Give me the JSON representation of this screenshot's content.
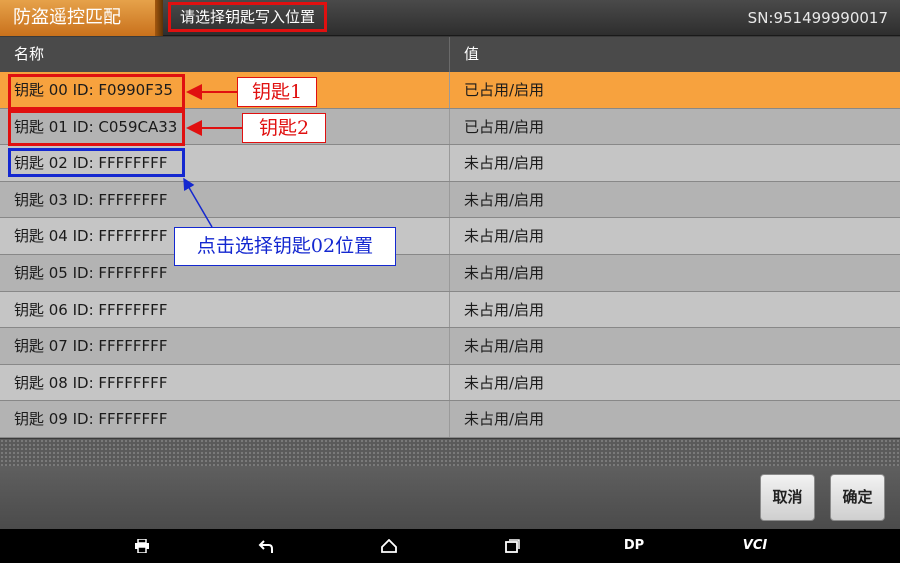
{
  "app": {
    "title": "防盗遥控匹配",
    "subtitle": "请选择钥匙写入位置",
    "serial": "SN:951499990017"
  },
  "table": {
    "headers": [
      "名称",
      "值"
    ],
    "rows": [
      {
        "name": "钥匙 00 ID: F0990F35",
        "value": "已占用/启用",
        "selected": true
      },
      {
        "name": "钥匙 01 ID: C059CA33",
        "value": "已占用/启用"
      },
      {
        "name": "钥匙 02 ID: FFFFFFFF",
        "value": "未占用/启用"
      },
      {
        "name": "钥匙 03 ID: FFFFFFFF",
        "value": "未占用/启用"
      },
      {
        "name": "钥匙 04 ID: FFFFFFFF",
        "value": "未占用/启用"
      },
      {
        "name": "钥匙 05 ID: FFFFFFFF",
        "value": "未占用/启用"
      },
      {
        "name": "钥匙 06 ID: FFFFFFFF",
        "value": "未占用/启用"
      },
      {
        "name": "钥匙 07 ID: FFFFFFFF",
        "value": "未占用/启用"
      },
      {
        "name": "钥匙 08 ID: FFFFFFFF",
        "value": "未占用/启用"
      },
      {
        "name": "钥匙 09 ID: FFFFFFFF",
        "value": "未占用/启用"
      }
    ]
  },
  "annotations": {
    "key1": "钥匙1",
    "key2": "钥匙2",
    "select_hint": "点击选择钥匙02位置"
  },
  "buttons": {
    "cancel": "取消",
    "ok": "确定"
  },
  "navbar": {
    "dp": "DP",
    "vci": "VCI",
    "icons": [
      "print-icon",
      "back-icon",
      "home-icon",
      "recent-apps-icon"
    ]
  },
  "colors": {
    "accent": "#f7a23e",
    "annotation_red": "#e01010",
    "annotation_blue": "#1428d0"
  }
}
